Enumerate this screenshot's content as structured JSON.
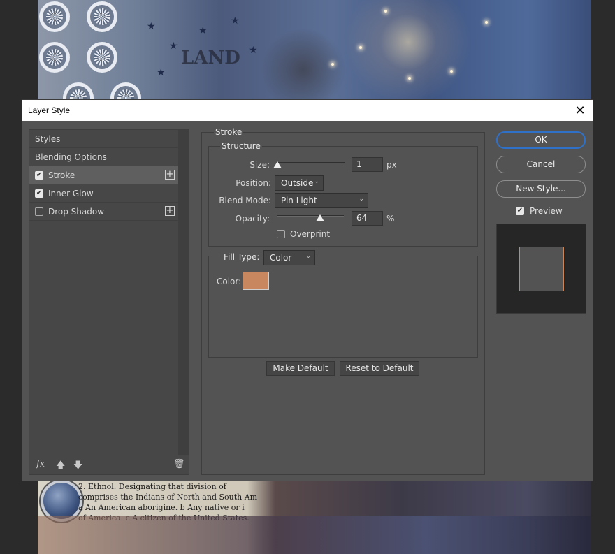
{
  "canvas": {
    "bottom_text_lines": [
      "2. Ethnol. Designating that division of",
      "comprises the Indians of North and South Am",
      "a An American aborigine. b Any native or i",
      "of America. c A citizen of the United States."
    ],
    "top_text": "LAND"
  },
  "dialog": {
    "title": "Layer Style",
    "close_icon": "close-icon"
  },
  "styles_panel": {
    "items": [
      {
        "label": "Styles",
        "checkbox": false,
        "checked": false,
        "add": false,
        "selected": false
      },
      {
        "label": "Blending Options",
        "checkbox": false,
        "checked": false,
        "add": false,
        "selected": false
      },
      {
        "label": "Stroke",
        "checkbox": true,
        "checked": true,
        "add": true,
        "selected": true
      },
      {
        "label": "Inner Glow",
        "checkbox": true,
        "checked": true,
        "add": false,
        "selected": false
      },
      {
        "label": "Drop Shadow",
        "checkbox": true,
        "checked": false,
        "add": true,
        "selected": false
      }
    ],
    "footer_icons": [
      "fx-icon",
      "move-up-icon",
      "move-down-icon",
      "trash-icon"
    ],
    "fx_label": "fx"
  },
  "stroke": {
    "group_title": "Stroke",
    "structure_title": "Structure",
    "size_label": "Size:",
    "size_value": "1",
    "size_unit": "px",
    "size_slider_level": 0.01,
    "position_label": "Position:",
    "position_value": "Outside",
    "blend_mode_label": "Blend Mode:",
    "blend_mode_value": "Pin Light",
    "opacity_label": "Opacity:",
    "opacity_value": "64",
    "opacity_unit": "%",
    "opacity_slider_level": 0.64,
    "overprint_label": "Overprint",
    "fill_type_label": "Fill Type:",
    "fill_type_value": "Color",
    "color_label": "Color:",
    "color_value": "#c98760",
    "make_default_label": "Make Default",
    "reset_default_label": "Reset to Default"
  },
  "actions": {
    "ok_label": "OK",
    "cancel_label": "Cancel",
    "new_style_label": "New Style...",
    "preview_label": "Preview",
    "preview_checked": true,
    "accent_color": "#2f70c9"
  }
}
